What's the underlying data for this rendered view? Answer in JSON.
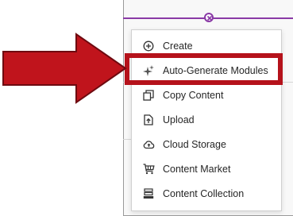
{
  "menu": {
    "items": [
      {
        "label": "Create",
        "icon": "plus-circle-icon"
      },
      {
        "label": "Auto-Generate Modules",
        "icon": "sparkle-icon"
      },
      {
        "label": "Copy Content",
        "icon": "copy-icon"
      },
      {
        "label": "Upload",
        "icon": "upload-icon"
      },
      {
        "label": "Cloud Storage",
        "icon": "cloud-upload-icon"
      },
      {
        "label": "Content Market",
        "icon": "cart-icon"
      },
      {
        "label": "Content Collection",
        "icon": "collection-icon"
      }
    ]
  },
  "colors": {
    "accent_divider": "#8a3aa6",
    "highlight_red": "#b5121b",
    "arrow_red": "#c0141c",
    "text": "#262626"
  },
  "callout": {
    "highlighted_item": "Auto-Generate Modules",
    "icon": "arrow-right-icon"
  }
}
